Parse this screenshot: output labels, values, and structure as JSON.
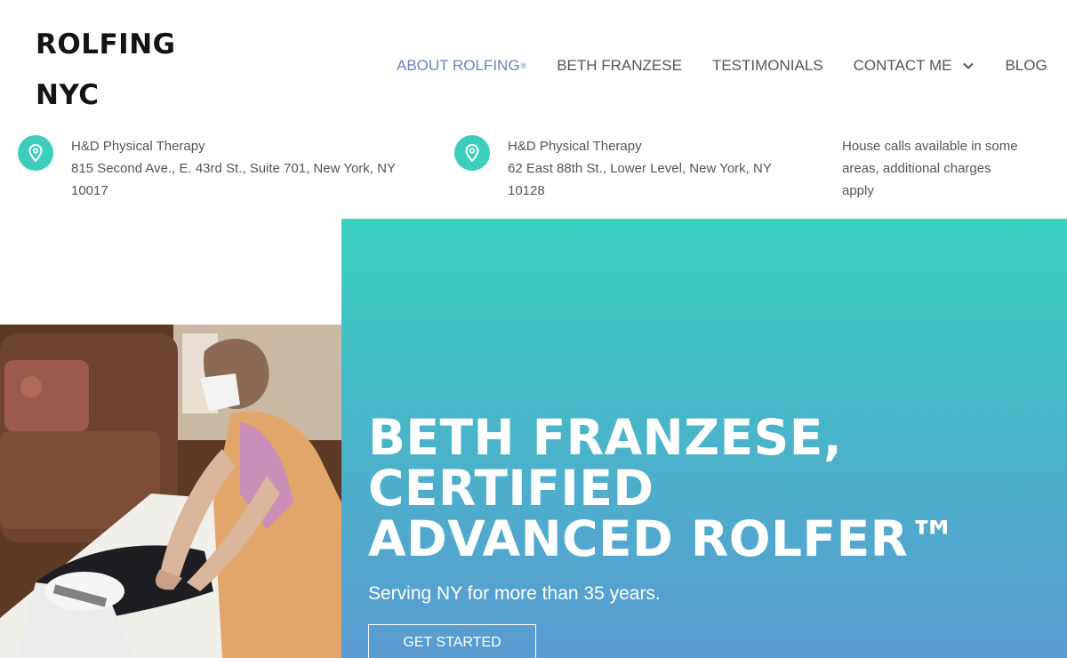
{
  "brand": {
    "line1": "ROLFING",
    "line2": "NYC"
  },
  "nav": {
    "items": [
      {
        "label": "ABOUT ROLFING",
        "sup": "®",
        "active": true
      },
      {
        "label": "BETH FRANZESE"
      },
      {
        "label": "TESTIMONIALS"
      },
      {
        "label": "CONTACT ME",
        "has_dropdown": true
      },
      {
        "label": "BLOG"
      }
    ]
  },
  "locations": [
    {
      "name": "H&D Physical Therapy",
      "address_line1": "815 Second Ave., E. 43rd St., Suite 701, New York, NY",
      "address_line2": "10017"
    },
    {
      "name": "H&D Physical Therapy",
      "address_line1": "62 East 88th St., Lower Level, New York, NY",
      "address_line2": "10128"
    }
  ],
  "house_calls": {
    "line1": "House calls available in some",
    "line2": "areas, additional charges",
    "line3": "apply"
  },
  "hero": {
    "title_line1": "BETH FRANZESE,",
    "title_line2": "CERTIFIED",
    "title_line3": "ADVANCED ROLFER™",
    "subtitle": "Serving NY for more than 35 years.",
    "cta_label": "GET STARTED"
  },
  "colors": {
    "accent": "#3ccdbd",
    "nav_active": "#6b7fc4",
    "hero_top": "#38d0bf",
    "hero_bottom": "#5a9bd2"
  }
}
